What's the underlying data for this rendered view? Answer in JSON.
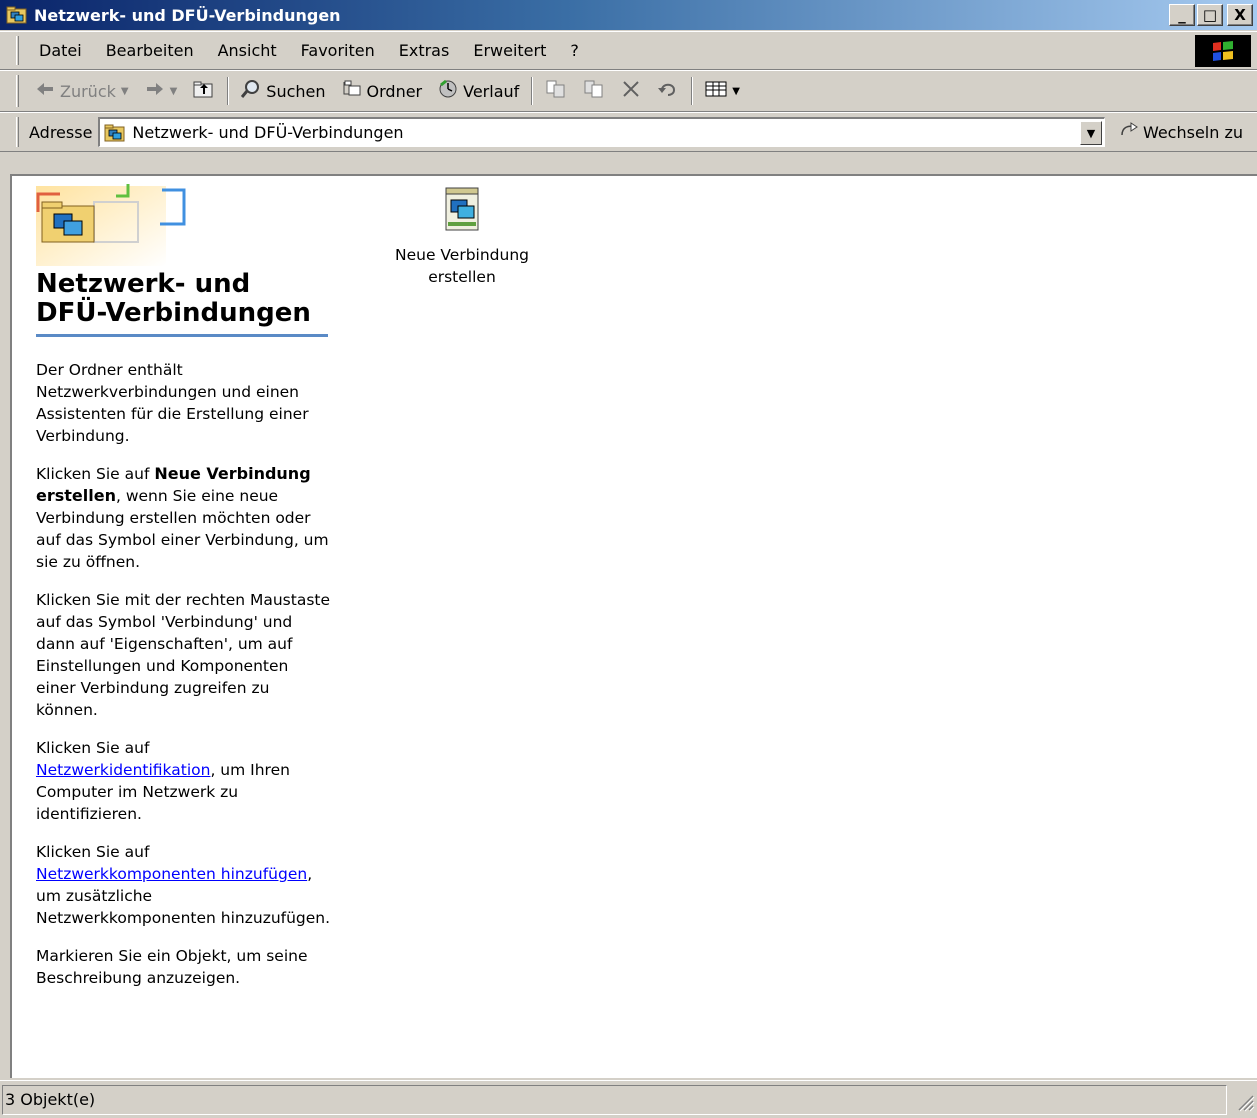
{
  "window": {
    "title": "Netzwerk- und DFÜ-Verbindungen",
    "buttons": {
      "minimize": "_",
      "maximize": "□",
      "close": "X"
    }
  },
  "menubar": {
    "items": [
      "Datei",
      "Bearbeiten",
      "Ansicht",
      "Favoriten",
      "Extras",
      "Erweitert",
      "?"
    ]
  },
  "toolbar": {
    "back": "Zurück",
    "search": "Suchen",
    "folders": "Ordner",
    "history": "Verlauf",
    "icons": [
      "back-arrow-icon",
      "forward-arrow-icon",
      "up-folder-icon",
      "search-icon",
      "folders-icon",
      "history-icon",
      "move-to-icon",
      "copy-to-icon",
      "delete-icon",
      "undo-icon",
      "views-icon"
    ]
  },
  "addressbar": {
    "label": "Adresse",
    "value": "Netzwerk- und DFÜ-Verbindungen",
    "go": "Wechseln zu"
  },
  "leftpane": {
    "title_line1": "Netzwerk- und",
    "title_line2": "DFÜ-Verbindungen",
    "p1": "Der Ordner enthält Netzwerkverbindungen und einen Assistenten für die Erstellung einer Verbindung.",
    "p2_pre": "Klicken Sie auf ",
    "p2_bold": "Neue Verbindung erstellen",
    "p2_post": ", wenn Sie eine neue Verbindung erstellen möchten oder auf das Symbol einer Verbindung, um sie zu öffnen.",
    "p3": "Klicken Sie mit der rechten Maustaste auf das Symbol 'Verbindung' und dann auf 'Eigenschaften', um auf Einstellungen und Komponenten einer Verbindung zugreifen zu können.",
    "p4_pre": "Klicken Sie auf ",
    "p4_link": "Netzwerkidentifikation",
    "p4_post": ", um Ihren Computer im Netzwerk zu identifizieren.",
    "p5_pre": "Klicken Sie auf ",
    "p5_link": "Netzwerkkomponenten hinzufügen",
    "p5_post": ", um zusätzliche Netzwerkkomponenten hinzuzufügen.",
    "p6": "Markieren Sie ein Objekt, um seine Beschreibung anzuzeigen."
  },
  "items": [
    {
      "label_line1": "Neue Verbindung",
      "label_line2": "erstellen",
      "icon": "new-connection-icon"
    }
  ],
  "statusbar": {
    "text": "3 Objekt(e)"
  },
  "colors": {
    "title_start": "#0a246a",
    "title_end": "#a6caf0",
    "link": "#0000ff",
    "chrome": "#d4d0c8"
  }
}
